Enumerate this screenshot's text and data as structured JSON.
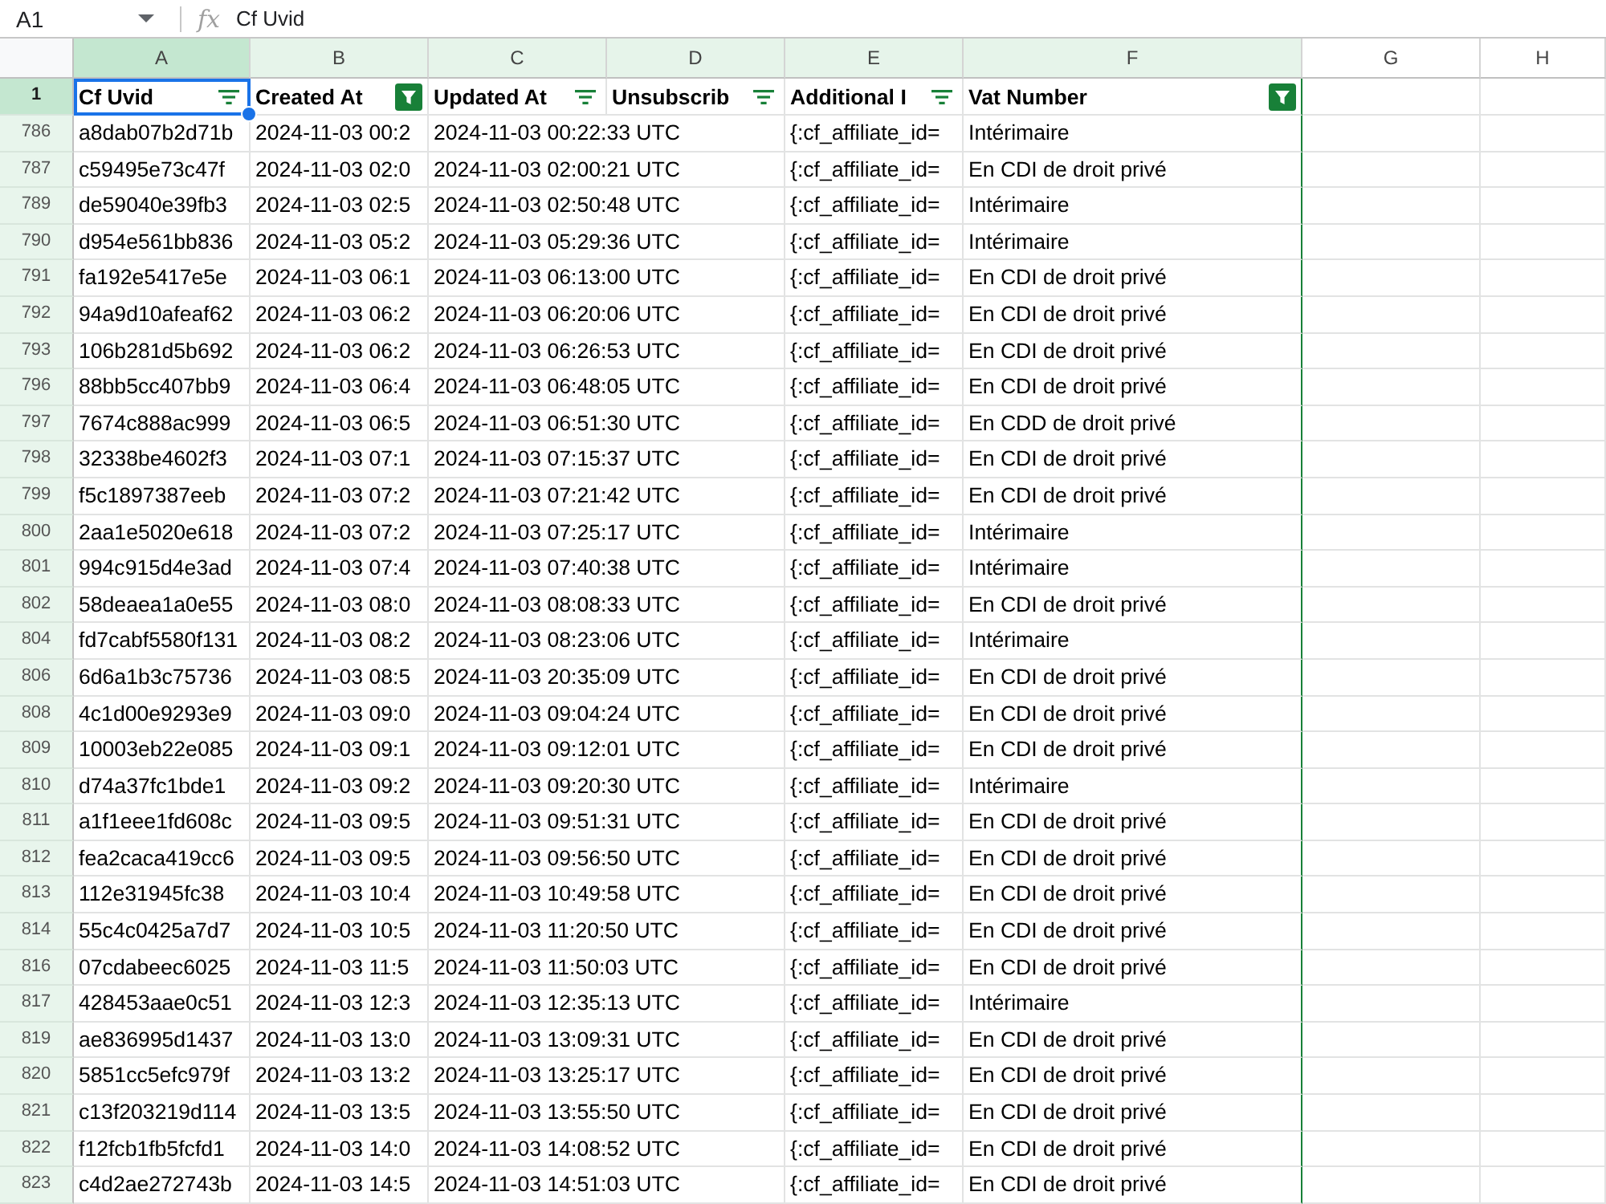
{
  "formula_bar": {
    "cell_ref": "A1",
    "function_label": "fx",
    "formula": "Cf Uvid"
  },
  "columns": [
    {
      "letter": "A",
      "selected": true,
      "in_filter": true
    },
    {
      "letter": "B",
      "selected": false,
      "in_filter": true
    },
    {
      "letter": "C",
      "selected": false,
      "in_filter": true
    },
    {
      "letter": "D",
      "selected": false,
      "in_filter": true
    },
    {
      "letter": "E",
      "selected": false,
      "in_filter": true
    },
    {
      "letter": "F",
      "selected": false,
      "in_filter": true
    },
    {
      "letter": "G",
      "selected": false,
      "in_filter": false
    },
    {
      "letter": "H",
      "selected": false,
      "in_filter": false
    }
  ],
  "header_row": {
    "number": "1",
    "selected": true,
    "cells": [
      {
        "text": "Cf Uvid",
        "filter_applied": false
      },
      {
        "text": "Created At",
        "filter_applied": true
      },
      {
        "text": "Updated At",
        "filter_applied": false
      },
      {
        "text": "Unsubscrib",
        "filter_applied": false
      },
      {
        "text": "Additional I",
        "filter_applied": false
      },
      {
        "text": "Vat Number",
        "filter_applied": true
      }
    ]
  },
  "rows": [
    {
      "number": "786",
      "selected": false,
      "col_a": "a8dab07b2d71b",
      "col_b": "2024-11-03 00:2",
      "col_c": "2024-11-03 00:22:33 UTC",
      "col_e": "{:cf_affiliate_id=",
      "col_f": "Intérimaire"
    },
    {
      "number": "787",
      "selected": false,
      "col_a": "c59495e73c47f",
      "col_b": "2024-11-03 02:0",
      "col_c": "2024-11-03 02:00:21 UTC",
      "col_e": "{:cf_affiliate_id=",
      "col_f": "En CDI de droit privé"
    },
    {
      "number": "789",
      "selected": false,
      "col_a": "de59040e39fb3",
      "col_b": "2024-11-03 02:5",
      "col_c": "2024-11-03 02:50:48 UTC",
      "col_e": "{:cf_affiliate_id=",
      "col_f": "Intérimaire"
    },
    {
      "number": "790",
      "selected": false,
      "col_a": "d954e561bb836",
      "col_b": "2024-11-03 05:2",
      "col_c": "2024-11-03 05:29:36 UTC",
      "col_e": "{:cf_affiliate_id=",
      "col_f": "Intérimaire"
    },
    {
      "number": "791",
      "selected": false,
      "col_a": "fa192e5417e5e",
      "col_b": "2024-11-03 06:1",
      "col_c": "2024-11-03 06:13:00 UTC",
      "col_e": "{:cf_affiliate_id=",
      "col_f": "En CDI de droit privé"
    },
    {
      "number": "792",
      "selected": false,
      "col_a": "94a9d10afeaf62",
      "col_b": "2024-11-03 06:2",
      "col_c": "2024-11-03 06:20:06 UTC",
      "col_e": "{:cf_affiliate_id=",
      "col_f": "En CDI de droit privé"
    },
    {
      "number": "793",
      "selected": false,
      "col_a": "106b281d5b692",
      "col_b": "2024-11-03 06:2",
      "col_c": "2024-11-03 06:26:53 UTC",
      "col_e": "{:cf_affiliate_id=",
      "col_f": "En CDI de droit privé"
    },
    {
      "number": "796",
      "selected": false,
      "col_a": "88bb5cc407bb9",
      "col_b": "2024-11-03 06:4",
      "col_c": "2024-11-03 06:48:05 UTC",
      "col_e": "{:cf_affiliate_id=",
      "col_f": "En CDI de droit privé"
    },
    {
      "number": "797",
      "selected": false,
      "col_a": "7674c888ac999",
      "col_b": "2024-11-03 06:5",
      "col_c": "2024-11-03 06:51:30 UTC",
      "col_e": "{:cf_affiliate_id=",
      "col_f": "En CDD de droit privé"
    },
    {
      "number": "798",
      "selected": false,
      "col_a": "32338be4602f3",
      "col_b": "2024-11-03 07:1",
      "col_c": "2024-11-03 07:15:37 UTC",
      "col_e": "{:cf_affiliate_id=",
      "col_f": "En CDI de droit privé"
    },
    {
      "number": "799",
      "selected": false,
      "col_a": "f5c1897387eeb",
      "col_b": "2024-11-03 07:2",
      "col_c": "2024-11-03 07:21:42 UTC",
      "col_e": "{:cf_affiliate_id=",
      "col_f": "En CDI de droit privé"
    },
    {
      "number": "800",
      "selected": false,
      "col_a": "2aa1e5020e618",
      "col_b": "2024-11-03 07:2",
      "col_c": "2024-11-03 07:25:17 UTC",
      "col_e": "{:cf_affiliate_id=",
      "col_f": "Intérimaire"
    },
    {
      "number": "801",
      "selected": false,
      "col_a": "994c915d4e3ad",
      "col_b": "2024-11-03 07:4",
      "col_c": "2024-11-03 07:40:38 UTC",
      "col_e": "{:cf_affiliate_id=",
      "col_f": "Intérimaire"
    },
    {
      "number": "802",
      "selected": false,
      "col_a": "58deaea1a0e55",
      "col_b": "2024-11-03 08:0",
      "col_c": "2024-11-03 08:08:33 UTC",
      "col_e": "{:cf_affiliate_id=",
      "col_f": "En CDI de droit privé"
    },
    {
      "number": "804",
      "selected": false,
      "col_a": "fd7cabf5580f131",
      "col_b": "2024-11-03 08:2",
      "col_c": "2024-11-03 08:23:06 UTC",
      "col_e": "{:cf_affiliate_id=",
      "col_f": "Intérimaire"
    },
    {
      "number": "806",
      "selected": false,
      "col_a": "6d6a1b3c75736",
      "col_b": "2024-11-03 08:5",
      "col_c": "2024-11-03 20:35:09 UTC",
      "col_e": "{:cf_affiliate_id=",
      "col_f": "En CDI de droit privé"
    },
    {
      "number": "808",
      "selected": false,
      "col_a": "4c1d00e9293e9",
      "col_b": "2024-11-03 09:0",
      "col_c": "2024-11-03 09:04:24 UTC",
      "col_e": "{:cf_affiliate_id=",
      "col_f": "En CDI de droit privé"
    },
    {
      "number": "809",
      "selected": false,
      "col_a": "10003eb22e085",
      "col_b": "2024-11-03 09:1",
      "col_c": "2024-11-03 09:12:01 UTC",
      "col_e": "{:cf_affiliate_id=",
      "col_f": "En CDI de droit privé"
    },
    {
      "number": "810",
      "selected": false,
      "col_a": "d74a37fc1bde1",
      "col_b": "2024-11-03 09:2",
      "col_c": "2024-11-03 09:20:30 UTC",
      "col_e": "{:cf_affiliate_id=",
      "col_f": "Intérimaire"
    },
    {
      "number": "811",
      "selected": false,
      "col_a": "a1f1eee1fd608c",
      "col_b": "2024-11-03 09:5",
      "col_c": "2024-11-03 09:51:31 UTC",
      "col_e": "{:cf_affiliate_id=",
      "col_f": "En CDI de droit privé"
    },
    {
      "number": "812",
      "selected": false,
      "col_a": "fea2caca419cc6",
      "col_b": "2024-11-03 09:5",
      "col_c": "2024-11-03 09:56:50 UTC",
      "col_e": "{:cf_affiliate_id=",
      "col_f": "En CDI de droit privé"
    },
    {
      "number": "813",
      "selected": false,
      "col_a": "112e31945fc38",
      "col_b": "2024-11-03 10:4",
      "col_c": "2024-11-03 10:49:58 UTC",
      "col_e": "{:cf_affiliate_id=",
      "col_f": "En CDI de droit privé"
    },
    {
      "number": "814",
      "selected": false,
      "col_a": "55c4c0425a7d7",
      "col_b": "2024-11-03 10:5",
      "col_c": "2024-11-03 11:20:50 UTC",
      "col_e": "{:cf_affiliate_id=",
      "col_f": "En CDI de droit privé"
    },
    {
      "number": "816",
      "selected": false,
      "col_a": "07cdabeec6025",
      "col_b": "2024-11-03 11:5",
      "col_c": "2024-11-03 11:50:03 UTC",
      "col_e": "{:cf_affiliate_id=",
      "col_f": "En CDI de droit privé"
    },
    {
      "number": "817",
      "selected": false,
      "col_a": "428453aae0c51",
      "col_b": "2024-11-03 12:3",
      "col_c": "2024-11-03 12:35:13 UTC",
      "col_e": "{:cf_affiliate_id=",
      "col_f": "Intérimaire"
    },
    {
      "number": "819",
      "selected": false,
      "col_a": "ae836995d1437",
      "col_b": "2024-11-03 13:0",
      "col_c": "2024-11-03 13:09:31 UTC",
      "col_e": "{:cf_affiliate_id=",
      "col_f": "En CDI de droit privé"
    },
    {
      "number": "820",
      "selected": false,
      "col_a": "5851cc5efc979f",
      "col_b": "2024-11-03 13:2",
      "col_c": "2024-11-03 13:25:17 UTC",
      "col_e": "{:cf_affiliate_id=",
      "col_f": "En CDI de droit privé"
    },
    {
      "number": "821",
      "selected": false,
      "col_a": "c13f203219d114",
      "col_b": "2024-11-03 13:5",
      "col_c": "2024-11-03 13:55:50 UTC",
      "col_e": "{:cf_affiliate_id=",
      "col_f": "En CDI de droit privé"
    },
    {
      "number": "822",
      "selected": false,
      "col_a": "f12fcb1fb5fcfd1",
      "col_b": "2024-11-03 14:0",
      "col_c": "2024-11-03 14:08:52 UTC",
      "col_e": "{:cf_affiliate_id=",
      "col_f": "En CDI de droit privé"
    },
    {
      "number": "823",
      "selected": false,
      "col_a": "c4d2ae272743b",
      "col_b": "2024-11-03 14:5",
      "col_c": "2024-11-03 14:51:03 UTC",
      "col_e": "{:cf_affiliate_id=",
      "col_f": "En CDI de droit privé"
    }
  ]
}
